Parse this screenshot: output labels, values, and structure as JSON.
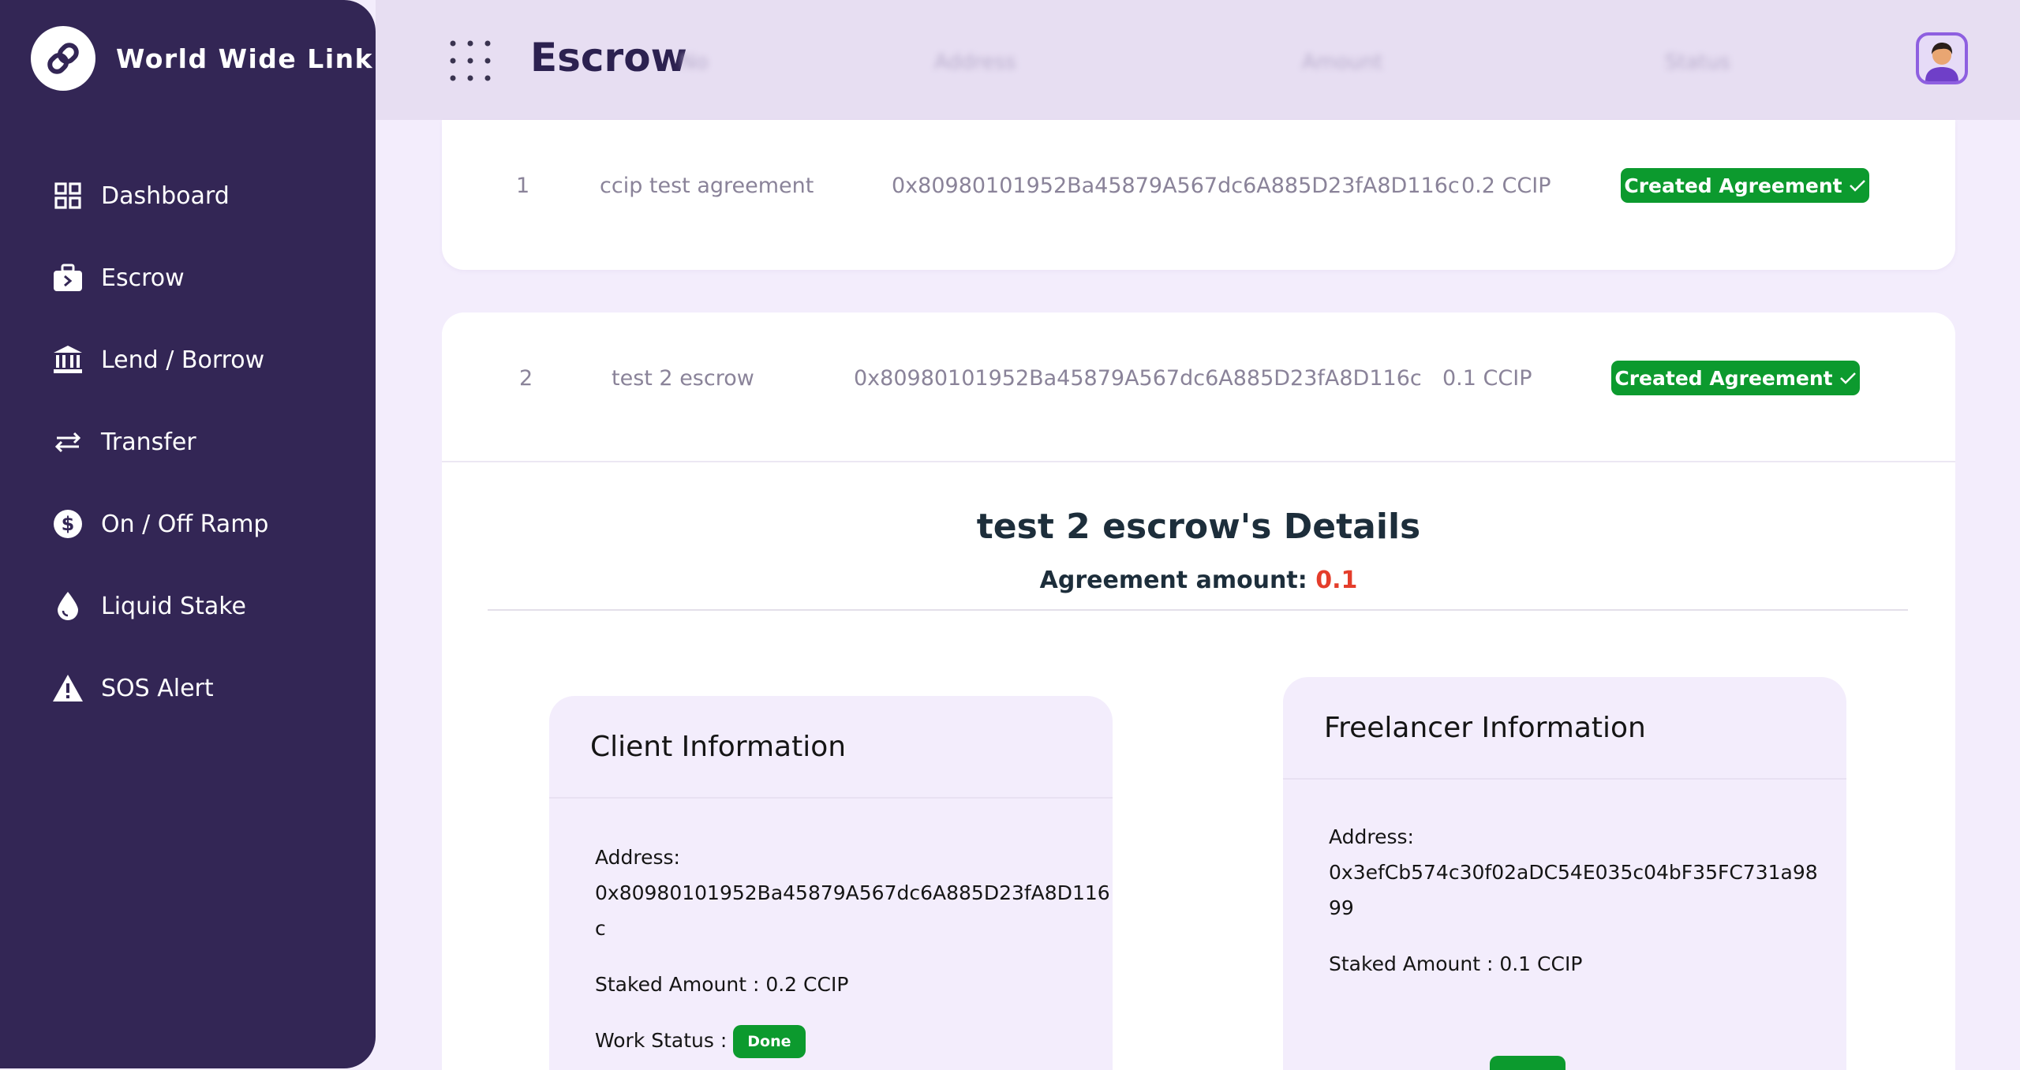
{
  "brand": {
    "name": "World Wide Link",
    "logo_icon": "chain-link-icon"
  },
  "sidebar": {
    "items": [
      {
        "label": "Dashboard",
        "icon": "dashboard-grid-icon"
      },
      {
        "label": "Escrow",
        "icon": "briefcase-icon"
      },
      {
        "label": "Lend / Borrow",
        "icon": "bank-icon"
      },
      {
        "label": "Transfer",
        "icon": "arrows-swap-icon"
      },
      {
        "label": "On / Off Ramp",
        "icon": "dollar-circle-icon"
      },
      {
        "label": "Liquid Stake",
        "icon": "droplet-icon"
      },
      {
        "label": "SOS Alert",
        "icon": "warning-triangle-icon"
      }
    ]
  },
  "header": {
    "title": "Escrow",
    "columns": [
      "No",
      "Address",
      "Amount",
      "Status"
    ]
  },
  "rows": [
    {
      "index": "1",
      "name": "ccip test agreement",
      "address": "0x80980101952Ba45879A567dc6A885D23fA8D116c",
      "amount": "0.2 CCIP",
      "status": "Created Agreement"
    },
    {
      "index": "2",
      "name": "test 2 escrow",
      "address": "0x80980101952Ba45879A567dc6A885D23fA8D116c",
      "amount": "0.1 CCIP",
      "status": "Created Agreement"
    }
  ],
  "details": {
    "title": "test 2 escrow's Details",
    "amount_label": "Agreement amount:",
    "amount_value": "0.1",
    "client": {
      "heading": "Client Information",
      "address_label": "Address:",
      "address_line1": "0x80980101952Ba45879A567dc6A885D23fA8D116",
      "address_line2": "c",
      "staked": "Staked Amount : 0.2 CCIP",
      "work_status_label": "Work Status :",
      "work_status": "Done"
    },
    "freelancer": {
      "heading": "Freelancer Information",
      "address_label": "Address:",
      "address_line1": "0x3efCb574c30f02aDC54E035c04bF35FC731a98",
      "address_line2": "99",
      "staked": "Staked Amount : 0.1 CCIP"
    }
  },
  "colors": {
    "sidebar": "#332655",
    "accent_green": "#0c9a2e",
    "amount_red": "#e43d2b"
  }
}
